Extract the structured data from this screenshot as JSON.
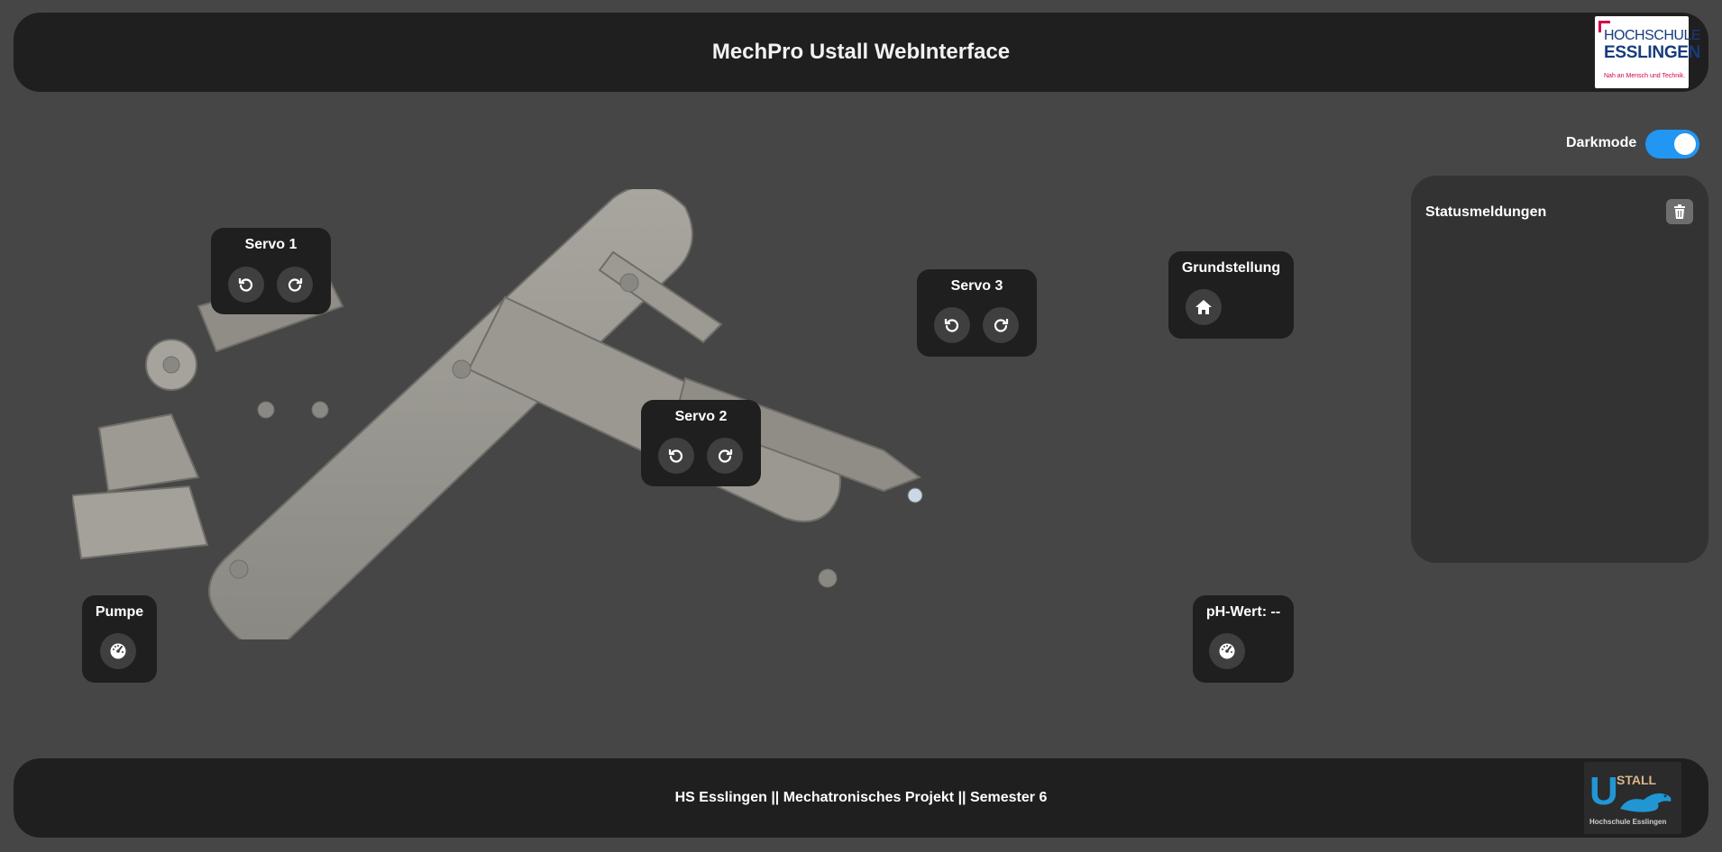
{
  "header": {
    "title": "MechPro Ustall WebInterface",
    "logo": {
      "line1": "HOCHSCHULE",
      "line2": "ESSLINGEN",
      "line3": "Nah an Mensch und Technik."
    }
  },
  "darkmode": {
    "label": "Darkmode",
    "enabled": true,
    "accent": "#2196f3"
  },
  "status": {
    "title": "Statusmeldungen",
    "messages": []
  },
  "controls": {
    "servo1": {
      "title": "Servo 1",
      "ccw_icon": "rotate-left-icon",
      "cw_icon": "rotate-right-icon"
    },
    "servo2": {
      "title": "Servo 2",
      "ccw_icon": "rotate-left-icon",
      "cw_icon": "rotate-right-icon"
    },
    "servo3": {
      "title": "Servo 3",
      "ccw_icon": "rotate-left-icon",
      "cw_icon": "rotate-right-icon"
    },
    "home": {
      "title": "Grundstellung",
      "icon": "home-icon"
    },
    "pump": {
      "title": "Pumpe",
      "icon": "gauge-icon"
    },
    "ph": {
      "title": "pH-Wert: --",
      "icon": "gauge-icon"
    }
  },
  "footer": {
    "text": "HS Esslingen || Mechatronisches Projekt || Semester 6",
    "logo": {
      "letter": "U",
      "word": "STALL",
      "sub": "Hochschule Esslingen"
    }
  },
  "colors": {
    "background": "#464646",
    "bar": "#1f1f1f",
    "panel": "#333333",
    "button": "#3f3f3f"
  }
}
